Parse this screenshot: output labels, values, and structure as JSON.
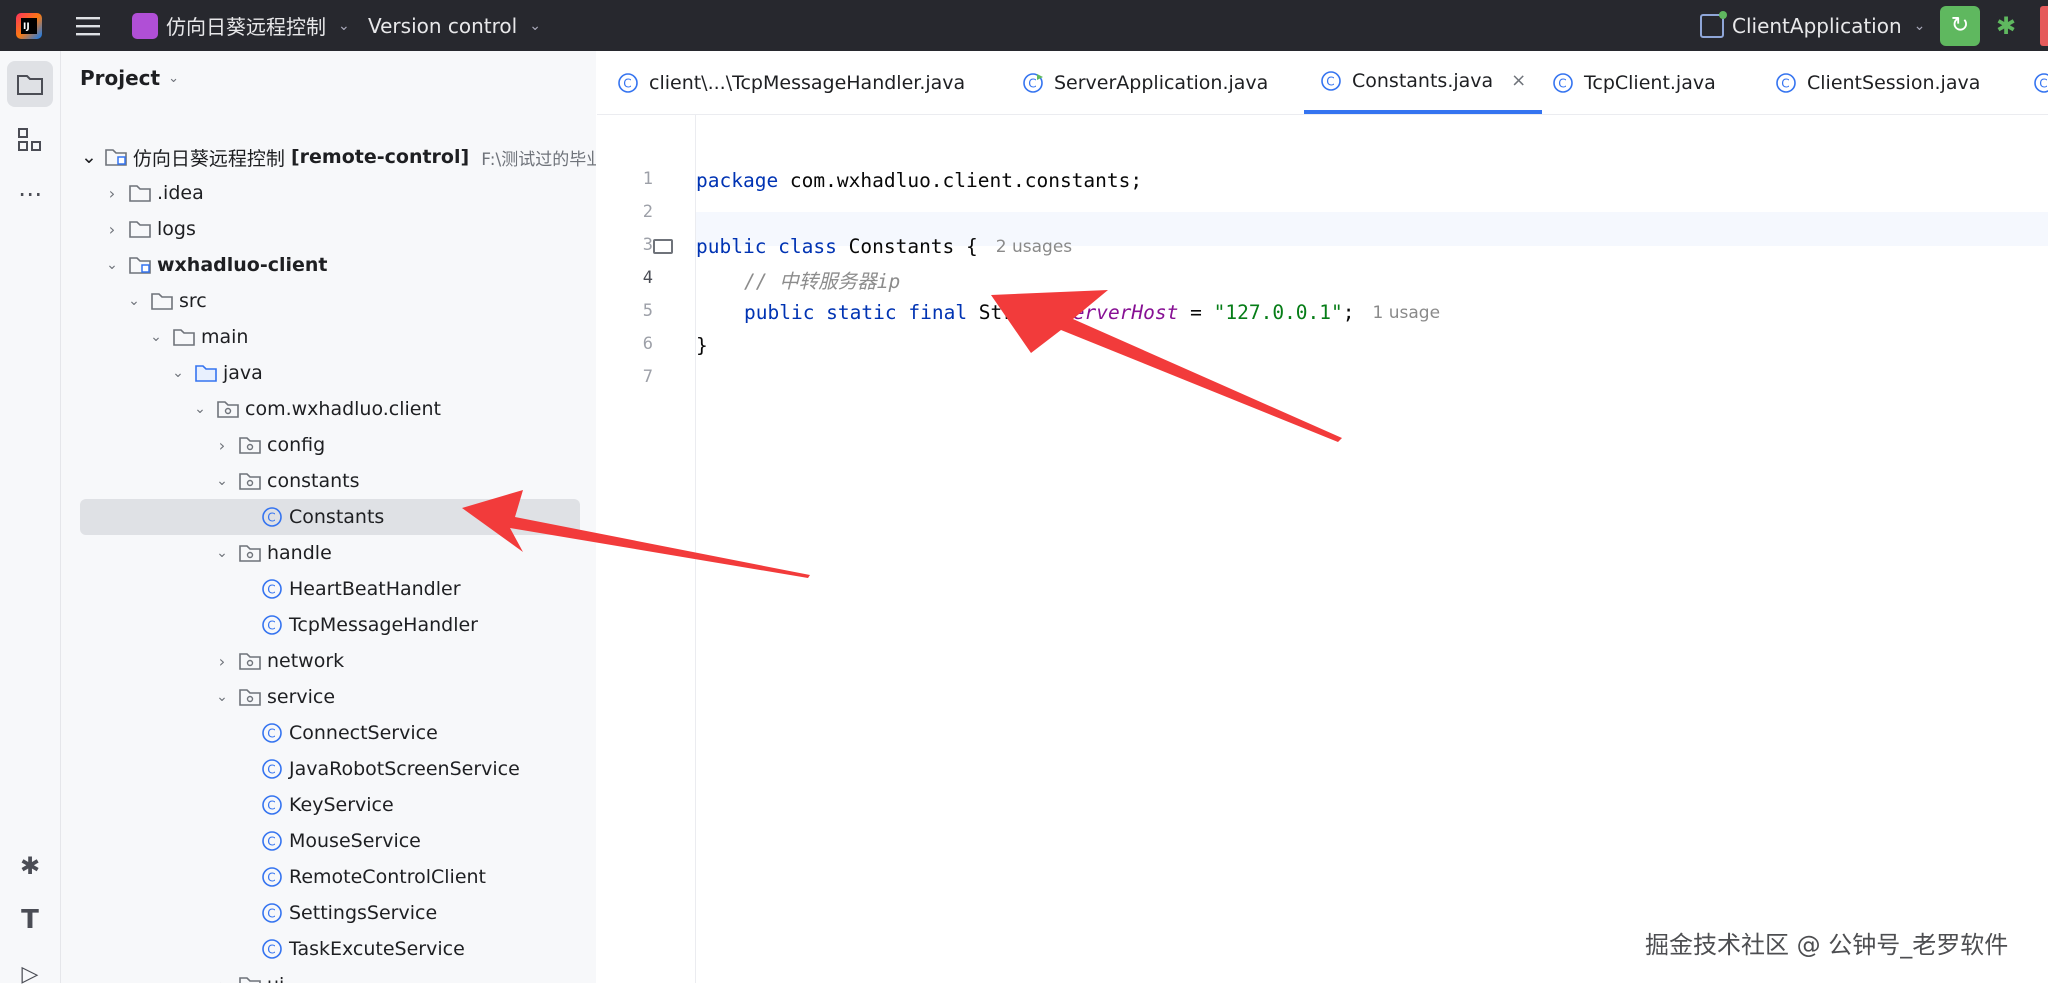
{
  "titlebar": {
    "project_name": "仿向日葵远程控制",
    "vcs": "Version control",
    "run_config": "ClientApplication"
  },
  "project_panel": {
    "title": "Project",
    "root": {
      "name": "仿向日葵远程控制",
      "module": "[remote-control]",
      "path": "F:\\测试过的毕业"
    },
    "items": [
      {
        "label": ".idea"
      },
      {
        "label": "logs"
      },
      {
        "label": "wxhadluo-client"
      },
      {
        "label": "src"
      },
      {
        "label": "main"
      },
      {
        "label": "java"
      },
      {
        "label": "com.wxhadluo.client"
      },
      {
        "label": "config"
      },
      {
        "label": "constants"
      },
      {
        "label": "Constants"
      },
      {
        "label": "handle"
      },
      {
        "label": "HeartBeatHandler"
      },
      {
        "label": "TcpMessageHandler"
      },
      {
        "label": "network"
      },
      {
        "label": "service"
      },
      {
        "label": "ConnectService"
      },
      {
        "label": "JavaRobotScreenService"
      },
      {
        "label": "KeyService"
      },
      {
        "label": "MouseService"
      },
      {
        "label": "RemoteControlClient"
      },
      {
        "label": "SettingsService"
      },
      {
        "label": "TaskExcuteService"
      },
      {
        "label": "ui"
      }
    ]
  },
  "tabs": [
    {
      "label": "client\\...\\TcpMessageHandler.java"
    },
    {
      "label": "ServerApplication.java"
    },
    {
      "label": "Constants.java"
    },
    {
      "label": "TcpClient.java"
    },
    {
      "label": "ClientSession.java"
    }
  ],
  "editor": {
    "line_numbers": [
      "1",
      "2",
      "3",
      "4",
      "5",
      "6",
      "7"
    ],
    "l1_kw": "package",
    "l1_rest": " com.wxhadluo.client.constants;",
    "l3_kw": "public class",
    "l3_rest": " Constants {",
    "l3_hint": "2 usages",
    "l4_comment": "// 中转服务器ip",
    "l5_kw": "public static final",
    "l5_type": " String ",
    "l5_field": "ServerHost",
    "l5_eq": " = ",
    "l5_str": "\"127.0.0.1\"",
    "l5_semi": ";",
    "l5_hint": "1 usage",
    "l6": "}"
  },
  "watermark": "掘金技术社区 @ 公钟号_老罗软件",
  "colors": {
    "arrow": "#f23b3b",
    "accent": "#3574f0"
  }
}
